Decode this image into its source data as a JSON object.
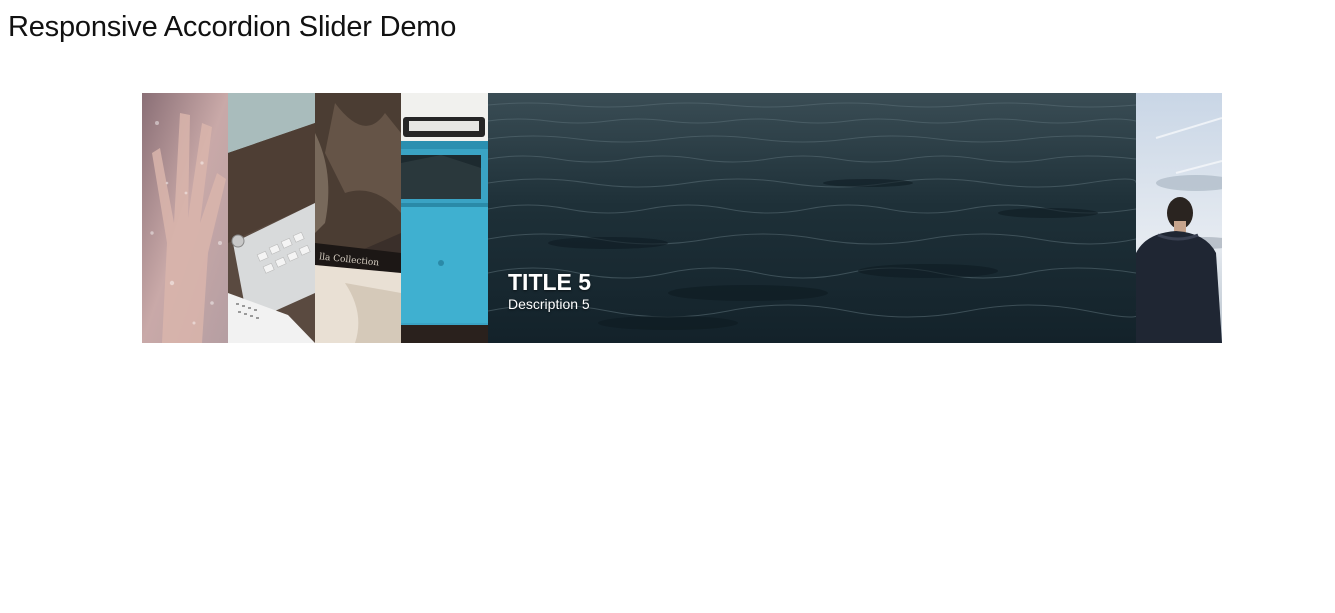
{
  "page": {
    "title": "Responsive Accordion Slider Demo"
  },
  "slider": {
    "active_index": 4,
    "panels": [
      {
        "scene": "hand on rainy glass"
      },
      {
        "scene": "keyboard and calendar on desk"
      },
      {
        "scene": "dog wearing collar"
      },
      {
        "scene": "blue vintage van"
      },
      {
        "scene": "dark ocean water",
        "title": "TITLE 5",
        "description": "Description 5"
      },
      {
        "scene": "man looking at sky"
      }
    ]
  }
}
